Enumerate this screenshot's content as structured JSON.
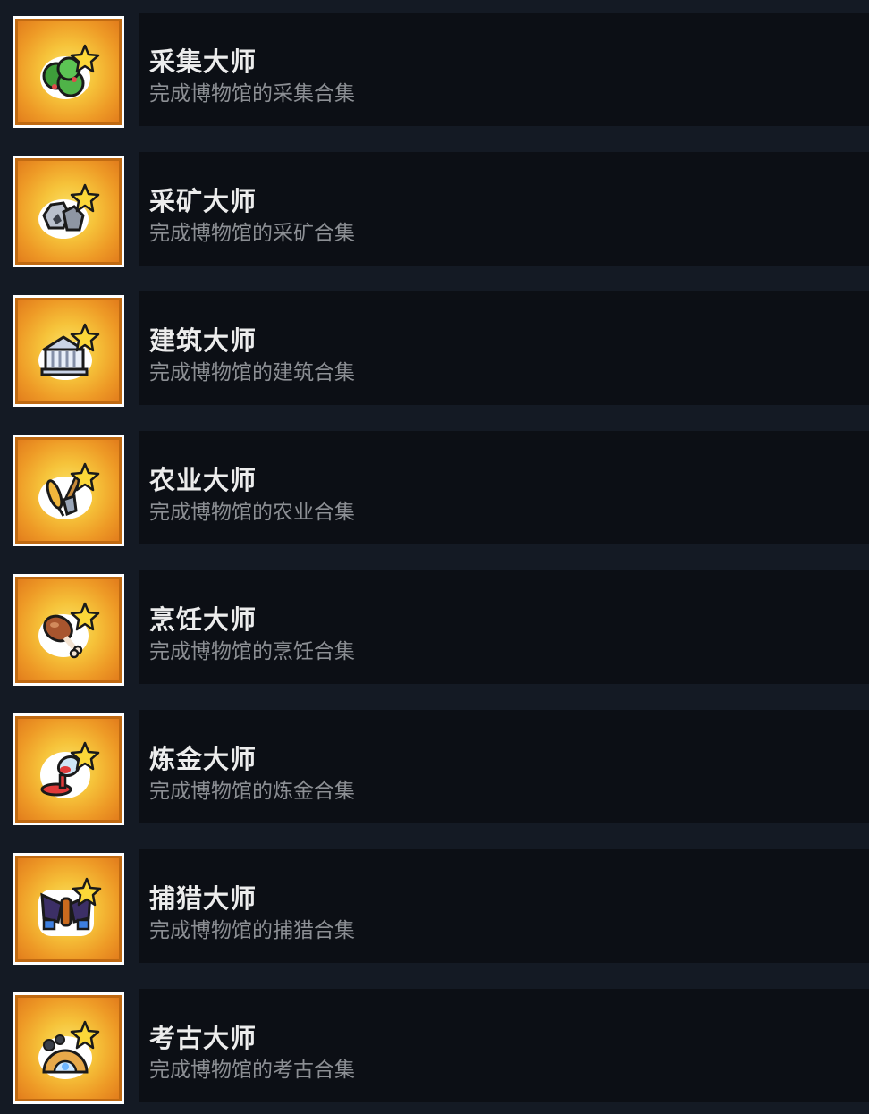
{
  "achievements": [
    {
      "title": "采集大师",
      "description": "完成博物馆的采集合集",
      "icon": "gathering-bush-icon"
    },
    {
      "title": "采矿大师",
      "description": "完成博物馆的采矿合集",
      "icon": "mining-ore-icon"
    },
    {
      "title": "建筑大师",
      "description": "完成博物馆的建筑合集",
      "icon": "building-temple-icon"
    },
    {
      "title": "农业大师",
      "description": "完成博物馆的农业合集",
      "icon": "farming-wheat-shovel-icon"
    },
    {
      "title": "烹饪大师",
      "description": "完成博物馆的烹饪合集",
      "icon": "cooking-drumstick-icon"
    },
    {
      "title": "炼金大师",
      "description": "完成博物馆的炼金合集",
      "icon": "alchemy-potion-icon"
    },
    {
      "title": "捕猎大师",
      "description": "完成博物馆的捕猎合集",
      "icon": "hunting-moth-icon"
    },
    {
      "title": "考古大师",
      "description": "完成博物馆的考古合集",
      "icon": "archaeology-dome-icon"
    }
  ],
  "colors": {
    "background": "#141a24",
    "panel": "#0c0f15",
    "title": "#ececec",
    "description": "#8c8f94",
    "badge_frame": "#ffffff",
    "badge_gold": "#f6c33a",
    "badge_orange": "#e27d1c"
  }
}
